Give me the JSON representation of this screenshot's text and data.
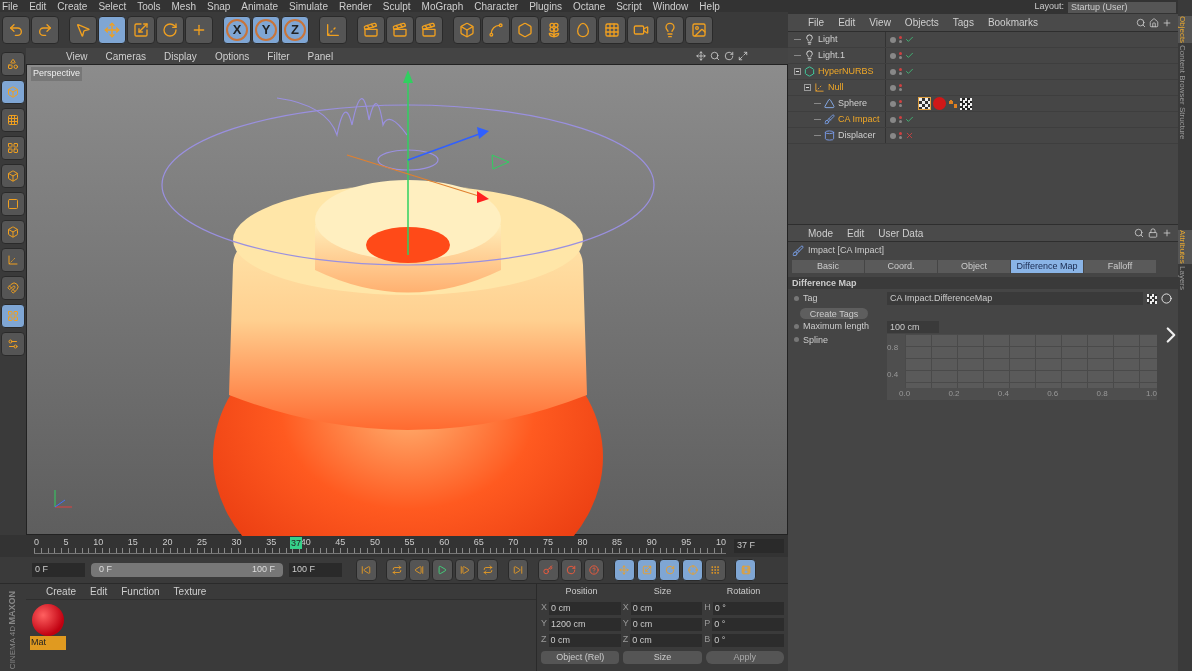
{
  "menu_bar": [
    "File",
    "Edit",
    "Create",
    "Select",
    "Tools",
    "Mesh",
    "Snap",
    "Animate",
    "Simulate",
    "Render",
    "Sculpt",
    "MoGraph",
    "Character",
    "Plugins",
    "Octane",
    "Script",
    "Window",
    "Help"
  ],
  "layout": {
    "label": "Layout:",
    "value": "Startup (User)"
  },
  "toolbar": [
    {
      "kind": "undo",
      "selected": false
    },
    {
      "kind": "redo",
      "selected": false
    },
    {
      "kind": "select",
      "selected": false
    },
    {
      "kind": "move",
      "selected": true
    },
    {
      "kind": "scale",
      "selected": false
    },
    {
      "kind": "rotate",
      "selected": false
    },
    {
      "kind": "add",
      "selected": false
    },
    {
      "kind": "axis",
      "label": "X",
      "selected": true
    },
    {
      "kind": "axis",
      "label": "Y",
      "selected": true
    },
    {
      "kind": "axis",
      "label": "Z",
      "selected": true
    },
    {
      "kind": "coords",
      "selected": false
    },
    {
      "kind": "render",
      "selected": false
    },
    {
      "kind": "render",
      "selected": false
    },
    {
      "kind": "render",
      "selected": false
    },
    {
      "kind": "cube",
      "selected": false
    },
    {
      "kind": "spline",
      "selected": false
    },
    {
      "kind": "nurbs",
      "selected": false
    },
    {
      "kind": "array",
      "selected": false
    },
    {
      "kind": "deformer",
      "selected": false
    },
    {
      "kind": "floor",
      "selected": false
    },
    {
      "kind": "camera",
      "selected": false
    },
    {
      "kind": "light",
      "selected": false
    },
    {
      "kind": "scene",
      "selected": false
    }
  ],
  "left_tools": [
    {
      "kind": "model",
      "selected": false
    },
    {
      "kind": "object",
      "selected": true
    },
    {
      "kind": "texture",
      "selected": false
    },
    {
      "kind": "workplane",
      "selected": false
    },
    {
      "kind": "points",
      "selected": false
    },
    {
      "kind": "edges",
      "selected": false
    },
    {
      "kind": "polygons",
      "selected": false
    },
    {
      "kind": "axis",
      "selected": false
    },
    {
      "kind": "magnet",
      "selected": false
    },
    {
      "kind": "grid",
      "selected": true
    },
    {
      "kind": "tweak",
      "selected": false
    }
  ],
  "viewport": {
    "menu": [
      "View",
      "Cameras",
      "Display",
      "Options",
      "Filter",
      "Panel"
    ],
    "camera_label": "Perspective"
  },
  "timeline": {
    "ticks": [
      "0",
      "5",
      "10",
      "15",
      "20",
      "25",
      "30",
      "35",
      "40",
      "45",
      "50",
      "55",
      "60",
      "65",
      "70",
      "75",
      "80",
      "85",
      "90",
      "95",
      "10"
    ],
    "playhead": {
      "label": "37",
      "level": 0.37
    },
    "current_frame": "37 F"
  },
  "transport": {
    "start": "0 F",
    "range_start": "0 F",
    "range_end": "100 F",
    "end": "100 F",
    "range_slider": {
      "level": 1
    },
    "buttons": [
      {
        "kind": "first",
        "selected": false
      },
      {
        "kind": "loop_back",
        "selected": false
      },
      {
        "kind": "prev",
        "selected": false
      },
      {
        "kind": "play",
        "selected": false
      },
      {
        "kind": "next",
        "selected": false
      },
      {
        "kind": "loop",
        "selected": false
      },
      {
        "kind": "last",
        "selected": false
      },
      {
        "kind": "record",
        "selected": false
      },
      {
        "kind": "autokey",
        "selected": false
      },
      {
        "kind": "help",
        "selected": false
      },
      {
        "kind": "move",
        "selected": true
      },
      {
        "kind": "scale",
        "selected": true
      },
      {
        "kind": "rotate",
        "selected": true
      },
      {
        "kind": "param",
        "selected": true
      },
      {
        "kind": "dots",
        "selected": false
      },
      {
        "kind": "film",
        "selected": true
      }
    ]
  },
  "materials": {
    "menu": [
      "Create",
      "Edit",
      "Function",
      "Texture"
    ],
    "items": [
      {
        "name": "Mat",
        "selected": true
      }
    ]
  },
  "brand": {
    "maker": "MAXON",
    "product": "CINEMA 4D"
  },
  "coordinates": {
    "headers": [
      "Position",
      "Size",
      "Rotation"
    ],
    "rows": [
      {
        "position_axis": "X",
        "position": "0 cm",
        "size_axis": "X",
        "size": "0 cm",
        "rotation_axis": "H",
        "rotation": "0 °"
      },
      {
        "position_axis": "Y",
        "position": "1200 cm",
        "size_axis": "Y",
        "size": "0 cm",
        "rotation_axis": "P",
        "rotation": "0 °"
      },
      {
        "position_axis": "Z",
        "position": "0 cm",
        "size_axis": "Z",
        "size": "0 cm",
        "rotation_axis": "B",
        "rotation": "0 °"
      }
    ],
    "mode": "Object (Rel)",
    "size_mode": "Size",
    "apply": "Apply"
  },
  "object_manager": {
    "menu": [
      "File",
      "Edit",
      "View",
      "Objects",
      "Tags",
      "Bookmarks"
    ],
    "objects": [
      {
        "name": "Light",
        "kind": "light",
        "selected": false,
        "enabled": true,
        "has_tags": false
      },
      {
        "name": "Light.1",
        "kind": "light",
        "selected": false,
        "enabled": true,
        "has_tags": false
      },
      {
        "name": "HyperNURBS",
        "kind": "nurbs",
        "selected": true,
        "enabled": true,
        "has_tags": false,
        "expanded": true,
        "children": [
          {
            "name": "Null",
            "kind": "null",
            "selected": true,
            "has_tags": false,
            "expanded": true,
            "children": [
              {
                "name": "Sphere",
                "kind": "sphere",
                "selected": false,
                "has_tags": true
              },
              {
                "name": "CA Impact",
                "kind": "impact",
                "selected": true,
                "enabled": true,
                "has_tags": false
              },
              {
                "name": "Displacer",
                "kind": "displacer",
                "selected": false,
                "enabled": false,
                "has_tags": false
              }
            ]
          }
        ]
      }
    ]
  },
  "attributes": {
    "menu": [
      "Mode",
      "Edit",
      "User Data"
    ],
    "title": "Impact [CA Impact]",
    "tabs": [
      {
        "label": "Basic",
        "selected": false
      },
      {
        "label": "Coord.",
        "selected": false
      },
      {
        "label": "Object",
        "selected": false
      },
      {
        "label": "Difference Map",
        "selected": true
      },
      {
        "label": "Falloff",
        "selected": false
      }
    ],
    "section": "Difference Map",
    "tag_label": "Tag",
    "tag_value": "CA Impact.DifferenceMap",
    "create_tags": "Create Tags",
    "max_length_label": "Maximum length",
    "max_length": "100 cm",
    "spline_label": "Spline",
    "graph": {
      "y_labels": [
        "0.8",
        "0.4"
      ],
      "x_labels": [
        "0.0",
        "0.2",
        "0.4",
        "0.6",
        "0.8",
        "1.0"
      ]
    }
  },
  "side_tabs_top": [
    {
      "label": "Objects",
      "selected": true
    },
    {
      "label": "Content Browser",
      "selected": false
    },
    {
      "label": "Structure",
      "selected": false
    }
  ],
  "side_tabs_bottom": [
    {
      "label": "Attributes",
      "selected": true
    },
    {
      "label": "Layers",
      "selected": false
    }
  ]
}
